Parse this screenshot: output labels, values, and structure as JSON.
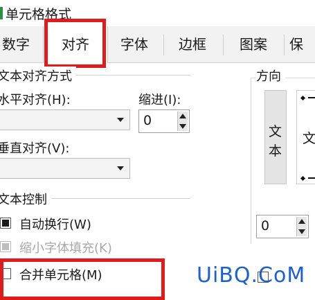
{
  "window": {
    "title": "单元格格式"
  },
  "tabs": [
    {
      "label": "数字"
    },
    {
      "label": "对齐"
    },
    {
      "label": "字体"
    },
    {
      "label": "边框"
    },
    {
      "label": "图案"
    },
    {
      "label": "保"
    }
  ],
  "active_tab": "对齐",
  "alignment": {
    "group_title": "文本对齐方式",
    "horizontal_label": "水平对齐(H):",
    "horizontal_value": "",
    "indent_label": "缩进(I):",
    "indent_value": "0",
    "vertical_label": "垂直对齐(V):",
    "vertical_value": ""
  },
  "text_control": {
    "group_title": "文本控制",
    "wrap_text": {
      "label": "自动换行(W)",
      "checked": true
    },
    "shrink_to_fit": {
      "label": "缩小字体填充(K)",
      "checked": true,
      "disabled": true
    },
    "merge_cells": {
      "label": "合并单元格(M)",
      "checked": false
    }
  },
  "orientation": {
    "group_title": "方向",
    "vertical_text": [
      "文",
      "本"
    ],
    "dial_text": "文",
    "degrees_value": "0"
  },
  "watermark": "UiBQ.CoM",
  "colors": {
    "annotation_red": "#e01b1b",
    "watermark_blue": "#1a5fd6"
  }
}
